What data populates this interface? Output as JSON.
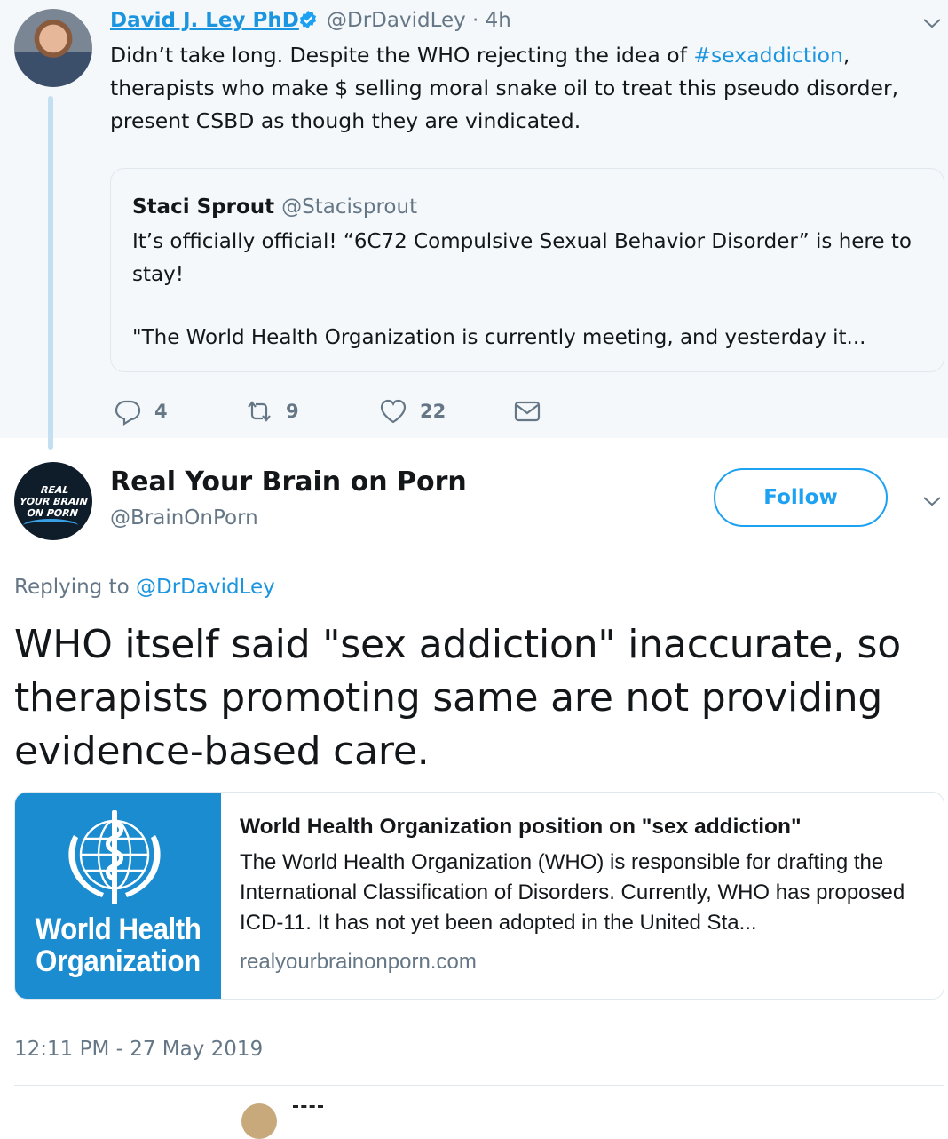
{
  "parent_tweet": {
    "author_name": "David J. Ley PhD",
    "handle_time": "@DrDavidLey · 4h",
    "text_before_hashtag": "Didn’t take long. Despite the WHO rejecting the idea of ",
    "hashtag": "#sexaddiction",
    "text_after_hashtag": ", therapists who make $ selling moral snake oil to treat this pseudo disorder, present CSBD as though they are vindicated.",
    "quote": {
      "author_name": "Staci Sprout",
      "handle": "@Stacisprout",
      "text": "It’s officially official! “6C72 Compulsive Sexual Behavior Disorder” is here to stay!",
      "text_2": "\"The World Health Organization is currently meeting, and yesterday it..."
    },
    "actions": {
      "replies": "4",
      "retweets": "9",
      "likes": "22"
    },
    "icons": [
      "reply-icon",
      "retweet-icon",
      "like-icon",
      "direct-message-icon",
      "verified-badge-icon",
      "chevron-down-icon"
    ]
  },
  "main_tweet": {
    "author_name": "Real Your Brain on Porn",
    "handle": "@BrainOnPorn",
    "avatar_text": [
      "REAL",
      "YOUR BRAIN",
      "ON PORN"
    ],
    "follow_label": "Follow",
    "replying_prefix": "Replying to ",
    "replying_to": "@DrDavidLey",
    "text": "WHO itself said \"sex addiction\" inaccurate, so therapists promoting same are not providing evidence-based care.",
    "card": {
      "image_text_line1": "World Health",
      "image_text_line2": "Organization",
      "title": "World Health Organization position on \"sex addiction\"",
      "description": "The World Health Organization (WHO) is responsible for drafting the International Classification of Disorders. Currently, WHO has proposed ICD-11. It has not yet been adopted in the United Sta...",
      "domain": "realyourbrainonporn.com"
    },
    "timestamp": "12:11 PM - 27 May 2019"
  },
  "colors": {
    "link_blue": "#1b95e0",
    "follow_blue": "#1da1f2",
    "muted_gray": "#657786",
    "parent_background": "#f5f8fa",
    "who_blue": "#1a8ccf"
  }
}
